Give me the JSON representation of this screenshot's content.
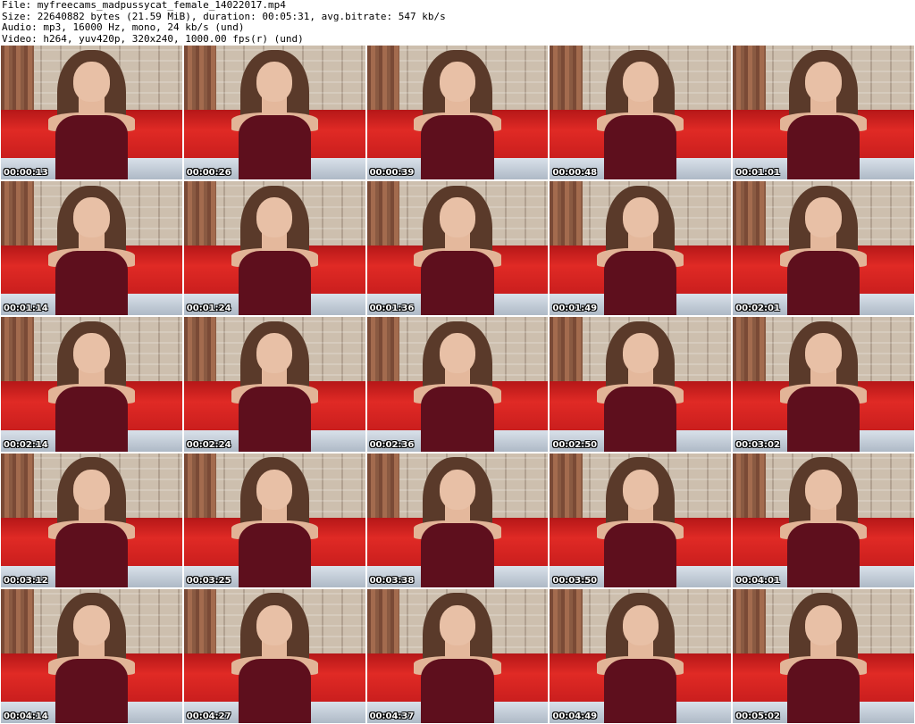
{
  "header": {
    "file_line": "File: myfreecams_madpussycat_female_14022017.mp4",
    "size_line": "Size: 22640882 bytes (21.59 MiB), duration: 00:05:31, avg.bitrate: 547 kb/s",
    "audio_line": "Audio: mp3, 16000 Hz, mono, 24 kb/s (und)",
    "video_line": "Video: h264, yuv420p, 320x240, 1000.00 fps(r) (und)"
  },
  "thumbnails": [
    {
      "timestamp": "00:00:13"
    },
    {
      "timestamp": "00:00:26"
    },
    {
      "timestamp": "00:00:39"
    },
    {
      "timestamp": "00:00:48"
    },
    {
      "timestamp": "00:01:01"
    },
    {
      "timestamp": "00:01:14"
    },
    {
      "timestamp": "00:01:24"
    },
    {
      "timestamp": "00:01:36"
    },
    {
      "timestamp": "00:01:49"
    },
    {
      "timestamp": "00:02:01"
    },
    {
      "timestamp": "00:02:14"
    },
    {
      "timestamp": "00:02:24"
    },
    {
      "timestamp": "00:02:36"
    },
    {
      "timestamp": "00:02:50"
    },
    {
      "timestamp": "00:03:02"
    },
    {
      "timestamp": "00:03:12"
    },
    {
      "timestamp": "00:03:25"
    },
    {
      "timestamp": "00:03:38"
    },
    {
      "timestamp": "00:03:50"
    },
    {
      "timestamp": "00:04:01"
    },
    {
      "timestamp": "00:04:14"
    },
    {
      "timestamp": "00:04:27"
    },
    {
      "timestamp": "00:04:37"
    },
    {
      "timestamp": "00:04:49"
    },
    {
      "timestamp": "00:05:02"
    }
  ]
}
